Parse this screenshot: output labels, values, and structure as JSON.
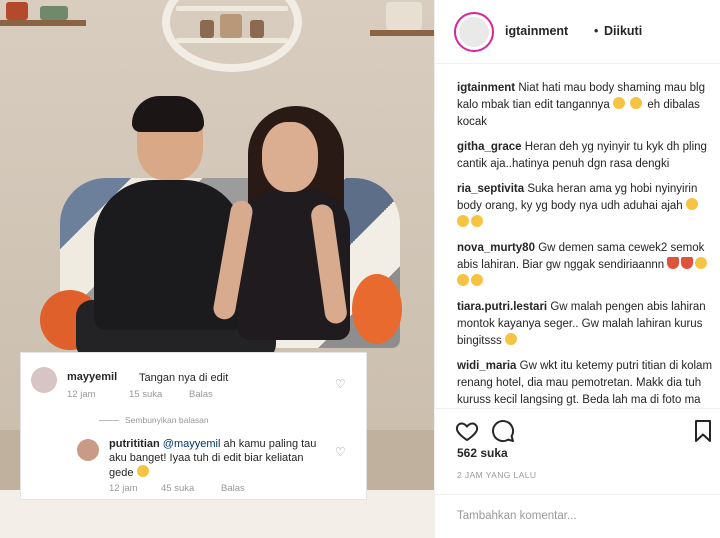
{
  "post": {
    "author": "igtainment",
    "separator": "•",
    "follow_status": "Diikuti",
    "likes": "562 suka",
    "time_ago": "2 JAM YANG LALU",
    "add_comment_placeholder": "Tambahkan komentar..."
  },
  "comments": [
    {
      "user": "igtainment",
      "text": "Niat hati mau body shaming mau blg kalo mbak tian edit tangannya",
      "suffix": "eh dibalas kocak"
    },
    {
      "user": "githa_grace",
      "text": "Heran deh yg nyinyir tu kyk dh pling cantik aja..hatinya penuh dgn rasa dengki"
    },
    {
      "user": "ria_septivita",
      "text": "Suka heran ama yg hobi nyinyirin body orang, ky yg body nya udh aduhai ajah"
    },
    {
      "user": "nova_murty80",
      "text": "Gw demen sama cewek2 semok abis lahiran. Biar gw nggak sendiriaannn"
    },
    {
      "user": "tiara.putri.lestari",
      "text": "Gw malah pengen abis lahiran montok kayanya seger.. Gw malah lahiran kurus bingitsss"
    },
    {
      "user": "widi_maria",
      "text": "Gw wkt itu ketemy putri titian di kolam renang hotel, dia mau pemotretan. Makk dia tuh kuruss kecil langsing gt. Beda lah ma di foto ma tv. Jadi"
    }
  ],
  "overlay": {
    "comment": {
      "user": "mayyemil",
      "text": "Tangan nya di edit",
      "age": "12 jam",
      "likes": "15 suka",
      "reply": "Balas"
    },
    "hide_replies": "Sembunyikan balasan",
    "reply": {
      "user": "putrititian",
      "mention": "@mayyemil",
      "text": "ah kamu paling tau aku banget! Iyaa tuh di edit biar keliatan gede",
      "age": "12 jam",
      "likes": "45 suka",
      "reply": "Balas"
    }
  },
  "icons": {
    "heart": "heart-icon",
    "comment": "comment-bubble-icon",
    "bookmark": "bookmark-icon"
  },
  "colors": {
    "link": "#003569",
    "muted": "#999999",
    "emoji_yellow": "#f6c343",
    "avatar_ring": "#d6249f"
  }
}
